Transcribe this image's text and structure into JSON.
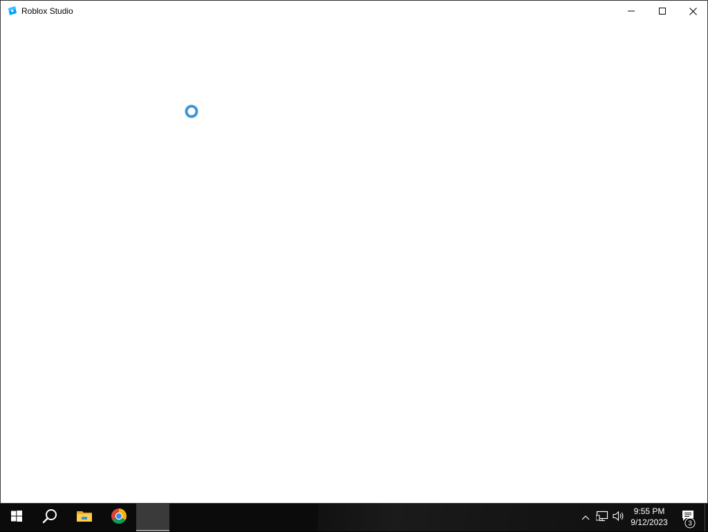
{
  "window": {
    "title": "Roblox Studio",
    "icon": "roblox-studio-icon",
    "buttons": {
      "minimize": "minimize-icon",
      "maximize": "maximize-icon",
      "close": "close-icon"
    }
  },
  "content": {
    "state": "loading",
    "spinner_color": "#3c96d6"
  },
  "taskbar": {
    "apps": [
      {
        "name": "start",
        "icon": "windows-start-icon"
      },
      {
        "name": "search",
        "icon": "search-icon"
      },
      {
        "name": "file-explorer",
        "icon": "folder-icon"
      },
      {
        "name": "chrome",
        "icon": "chrome-icon"
      },
      {
        "name": "roblox-studio",
        "icon": "roblox-studio-icon",
        "active": true
      }
    ],
    "tray": {
      "time": "9:55 PM",
      "date": "9/12/2023",
      "notification_count": "3"
    }
  },
  "colors": {
    "taskbar": "#0b0b0b",
    "window_bg": "#ffffff",
    "accent_blue": "#3c96d6"
  }
}
